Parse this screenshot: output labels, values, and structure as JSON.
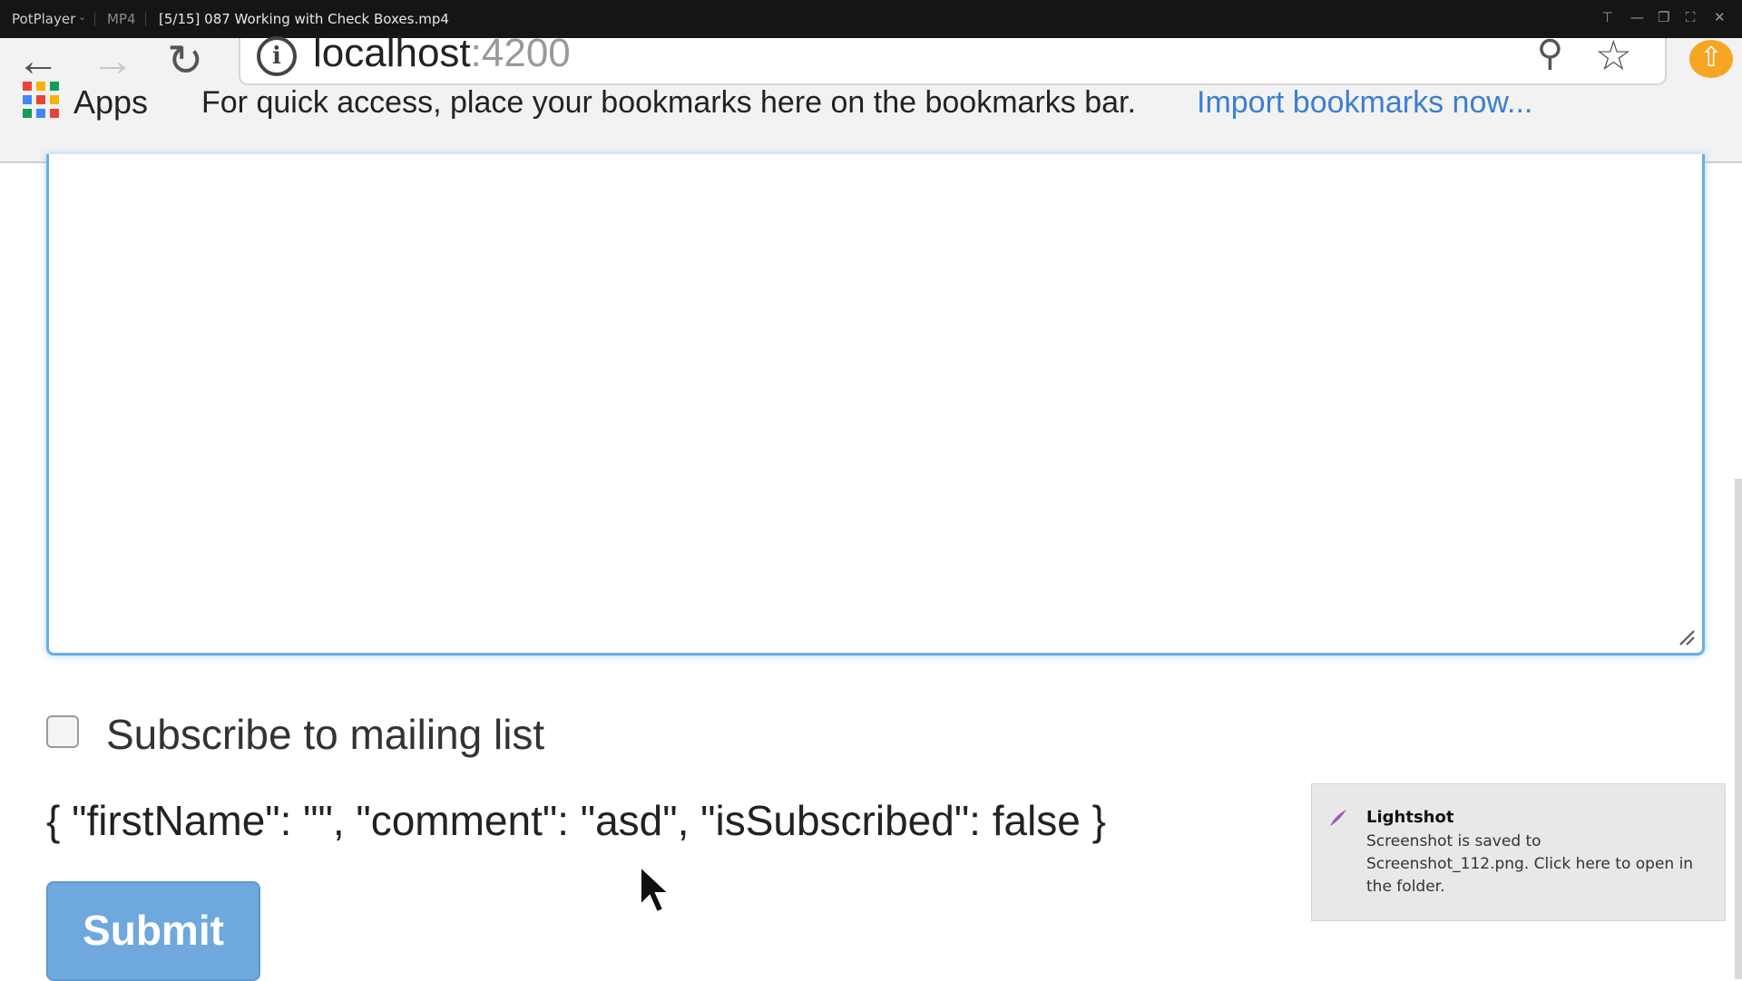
{
  "player": {
    "brand": "PotPlayer",
    "format": "MP4",
    "file_title": "[5/15] 087 Working with Check Boxes.mp4"
  },
  "browser": {
    "url_host": "localhost",
    "url_port": ":4200",
    "apps_label": "Apps",
    "bookmarks_hint": "For quick access, place your bookmarks here on the bookmarks bar.",
    "import_link": "Import bookmarks now..."
  },
  "form": {
    "checkbox_label": "Subscribe to mailing list",
    "checkbox_checked": false,
    "json_output": "{ \"firstName\": \"\", \"comment\": \"asd\", \"isSubscribed\": false }",
    "submit_label": "Submit"
  },
  "notification": {
    "title": "Lightshot",
    "body": "Screenshot is saved to Screenshot_112.png. Click here to open in the folder."
  },
  "colors": {
    "focus_border": "#66afe9",
    "submit_bg": "#6fa8dc",
    "link": "#3b7fd1",
    "update_badge": "#f5a623"
  }
}
